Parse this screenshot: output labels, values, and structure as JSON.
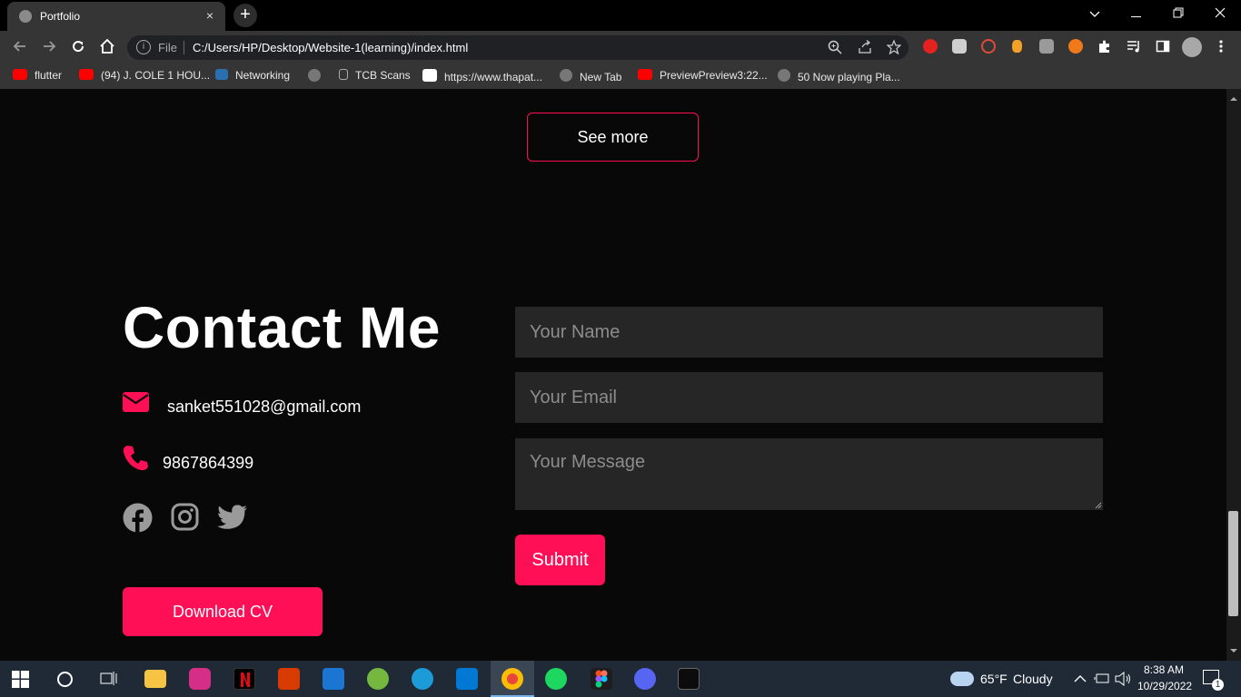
{
  "browser": {
    "tab_title": "Portfolio",
    "tab_close": "×",
    "new_tab": "+",
    "url_prefix": "File",
    "url": "C:/Users/HP/Desktop/Website-1(learning)/index.html",
    "bookmarks": [
      {
        "label": "flutter",
        "icon": "youtube-icon"
      },
      {
        "label": "(94) J. COLE 1 HOU...",
        "icon": "youtube-icon"
      },
      {
        "label": "Networking",
        "icon": "networking-icon"
      },
      {
        "label": "",
        "icon": "globe-icon"
      },
      {
        "label": "TCB Scans",
        "icon": "page-icon"
      },
      {
        "label": "https://www.thapat...",
        "icon": "site-icon"
      },
      {
        "label": "New Tab",
        "icon": "globe-icon"
      },
      {
        "label": "PreviewPreview3:22...",
        "icon": "youtube-icon"
      },
      {
        "label": "50 Now playing Pla...",
        "icon": "globe-icon"
      }
    ]
  },
  "page": {
    "see_more": "See more",
    "contact_title": "Contact Me",
    "email": "sanket551028@gmail.com",
    "phone": "9867864399",
    "download_cv": "Download CV",
    "form": {
      "name_placeholder": "Your Name",
      "email_placeholder": "Your Email",
      "message_placeholder": "Your Message",
      "submit": "Submit"
    },
    "accent_color": "#ff0f55"
  },
  "taskbar": {
    "weather_temp": "65°F",
    "weather_text": "Cloudy",
    "time": "8:38 AM",
    "date": "10/29/2022",
    "notification_count": "1"
  }
}
